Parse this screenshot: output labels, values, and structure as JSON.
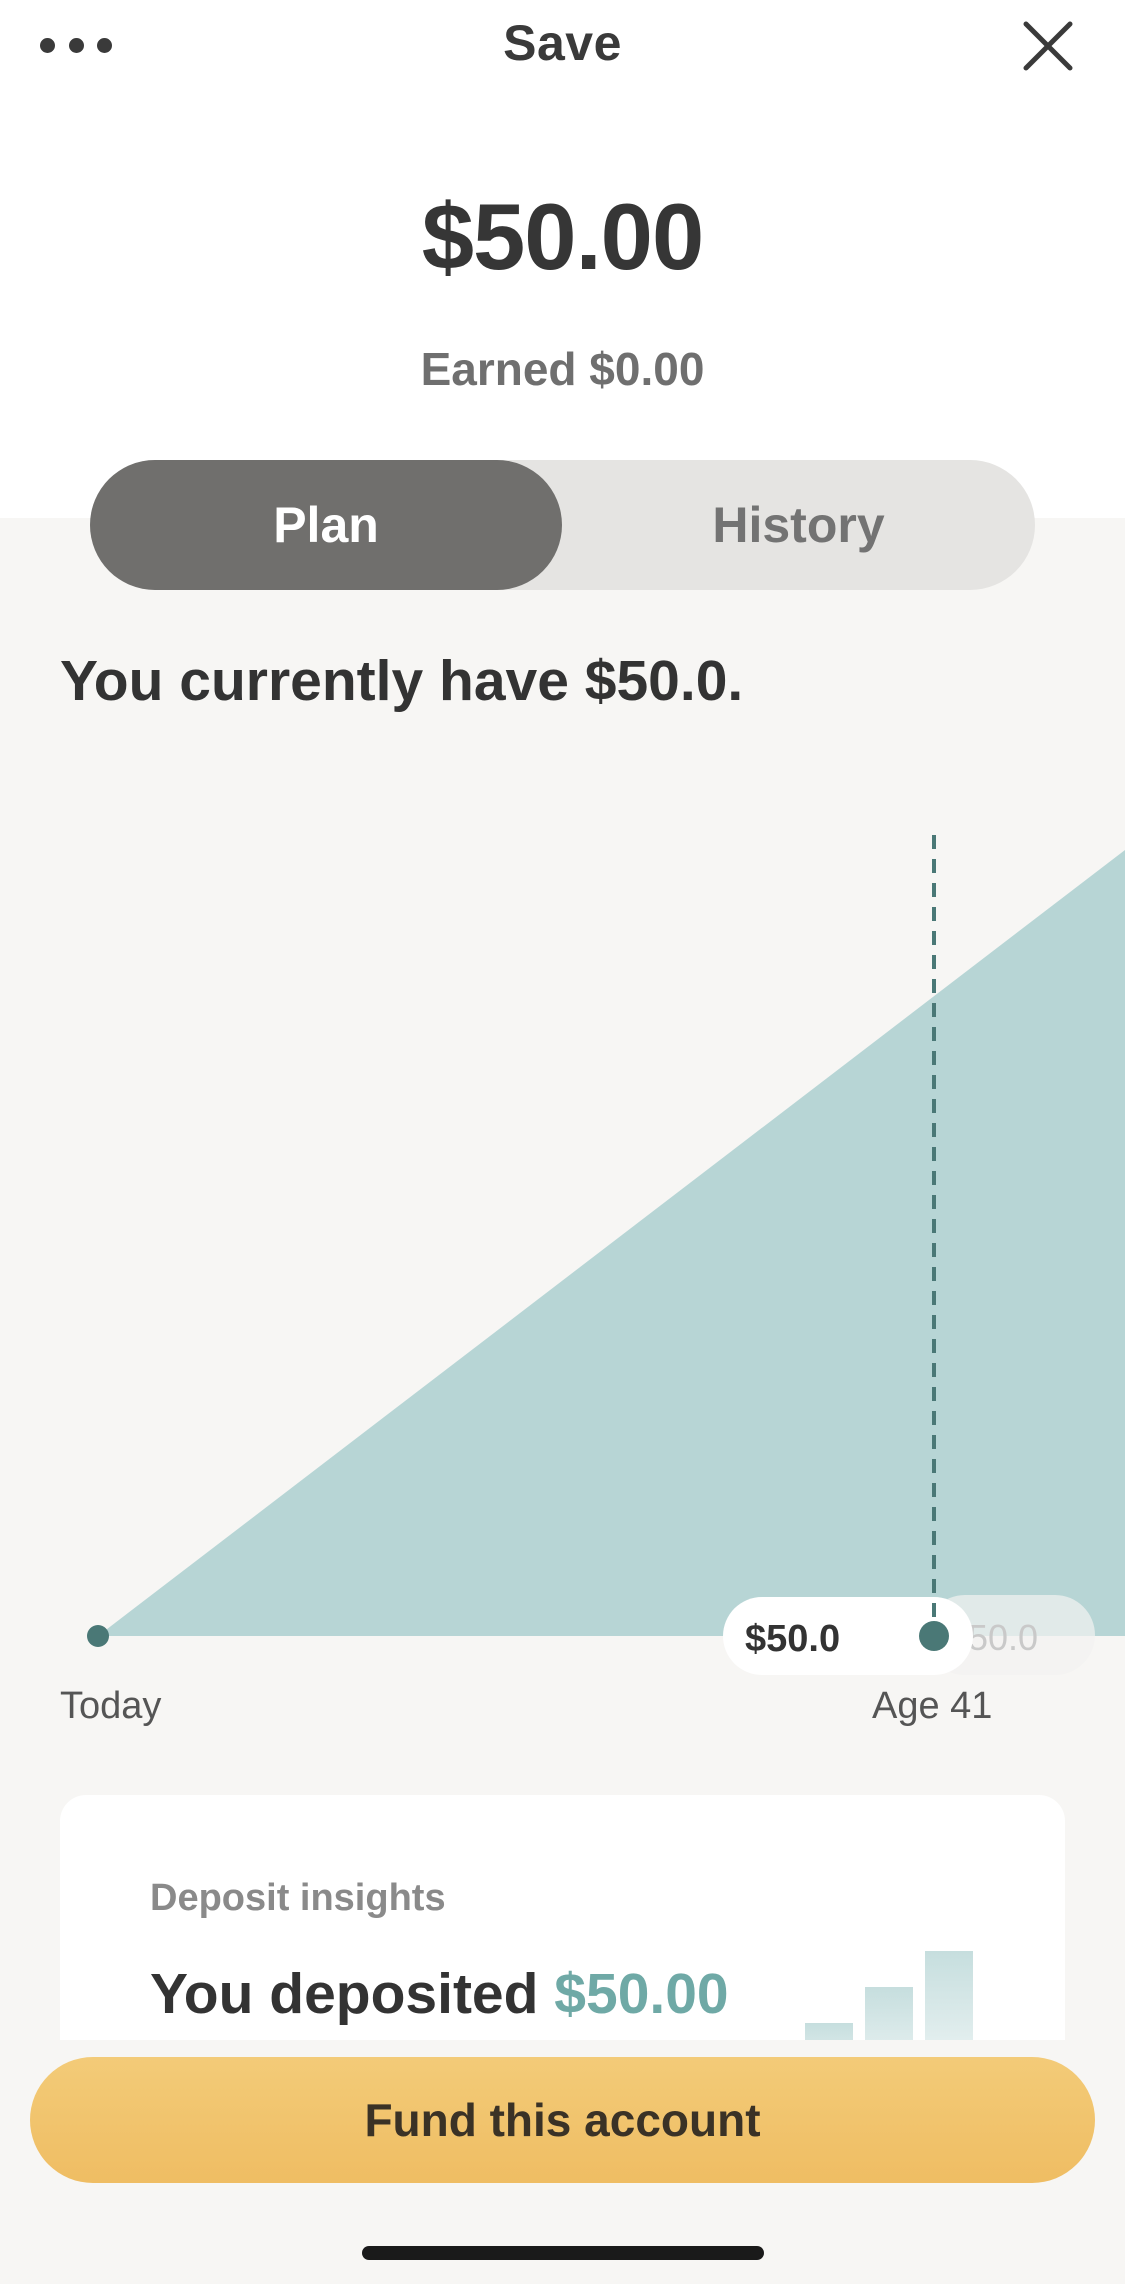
{
  "header": {
    "title": "Save",
    "more_icon": "more-horizontal-icon",
    "close_icon": "close-icon"
  },
  "balance": {
    "amount": "$50.00",
    "earned": "Earned $0.00"
  },
  "tabs": [
    {
      "label": "Plan",
      "active": true
    },
    {
      "label": "History",
      "active": false
    }
  ],
  "plan": {
    "headline": "You currently have $50.0."
  },
  "chart_data": {
    "type": "area",
    "x": [
      "Today",
      "Age 41"
    ],
    "x_tick_labels": [
      "Today",
      "Age 41"
    ],
    "series": [
      {
        "values": [
          0,
          50.0
        ]
      }
    ],
    "marker_label": "$50.0",
    "faded_label": "50.0",
    "colors": {
      "area": "#b7d5d5",
      "marker": "#4a7876"
    }
  },
  "insights": {
    "title": "Deposit insights",
    "text_prefix": "You deposited",
    "amount": "$50.00"
  },
  "cta": {
    "label": "Fund this account"
  },
  "colors": {
    "accent_teal": "#6fa9a6",
    "button_gold": "#f0c067",
    "segment_active": "#706f6d"
  }
}
